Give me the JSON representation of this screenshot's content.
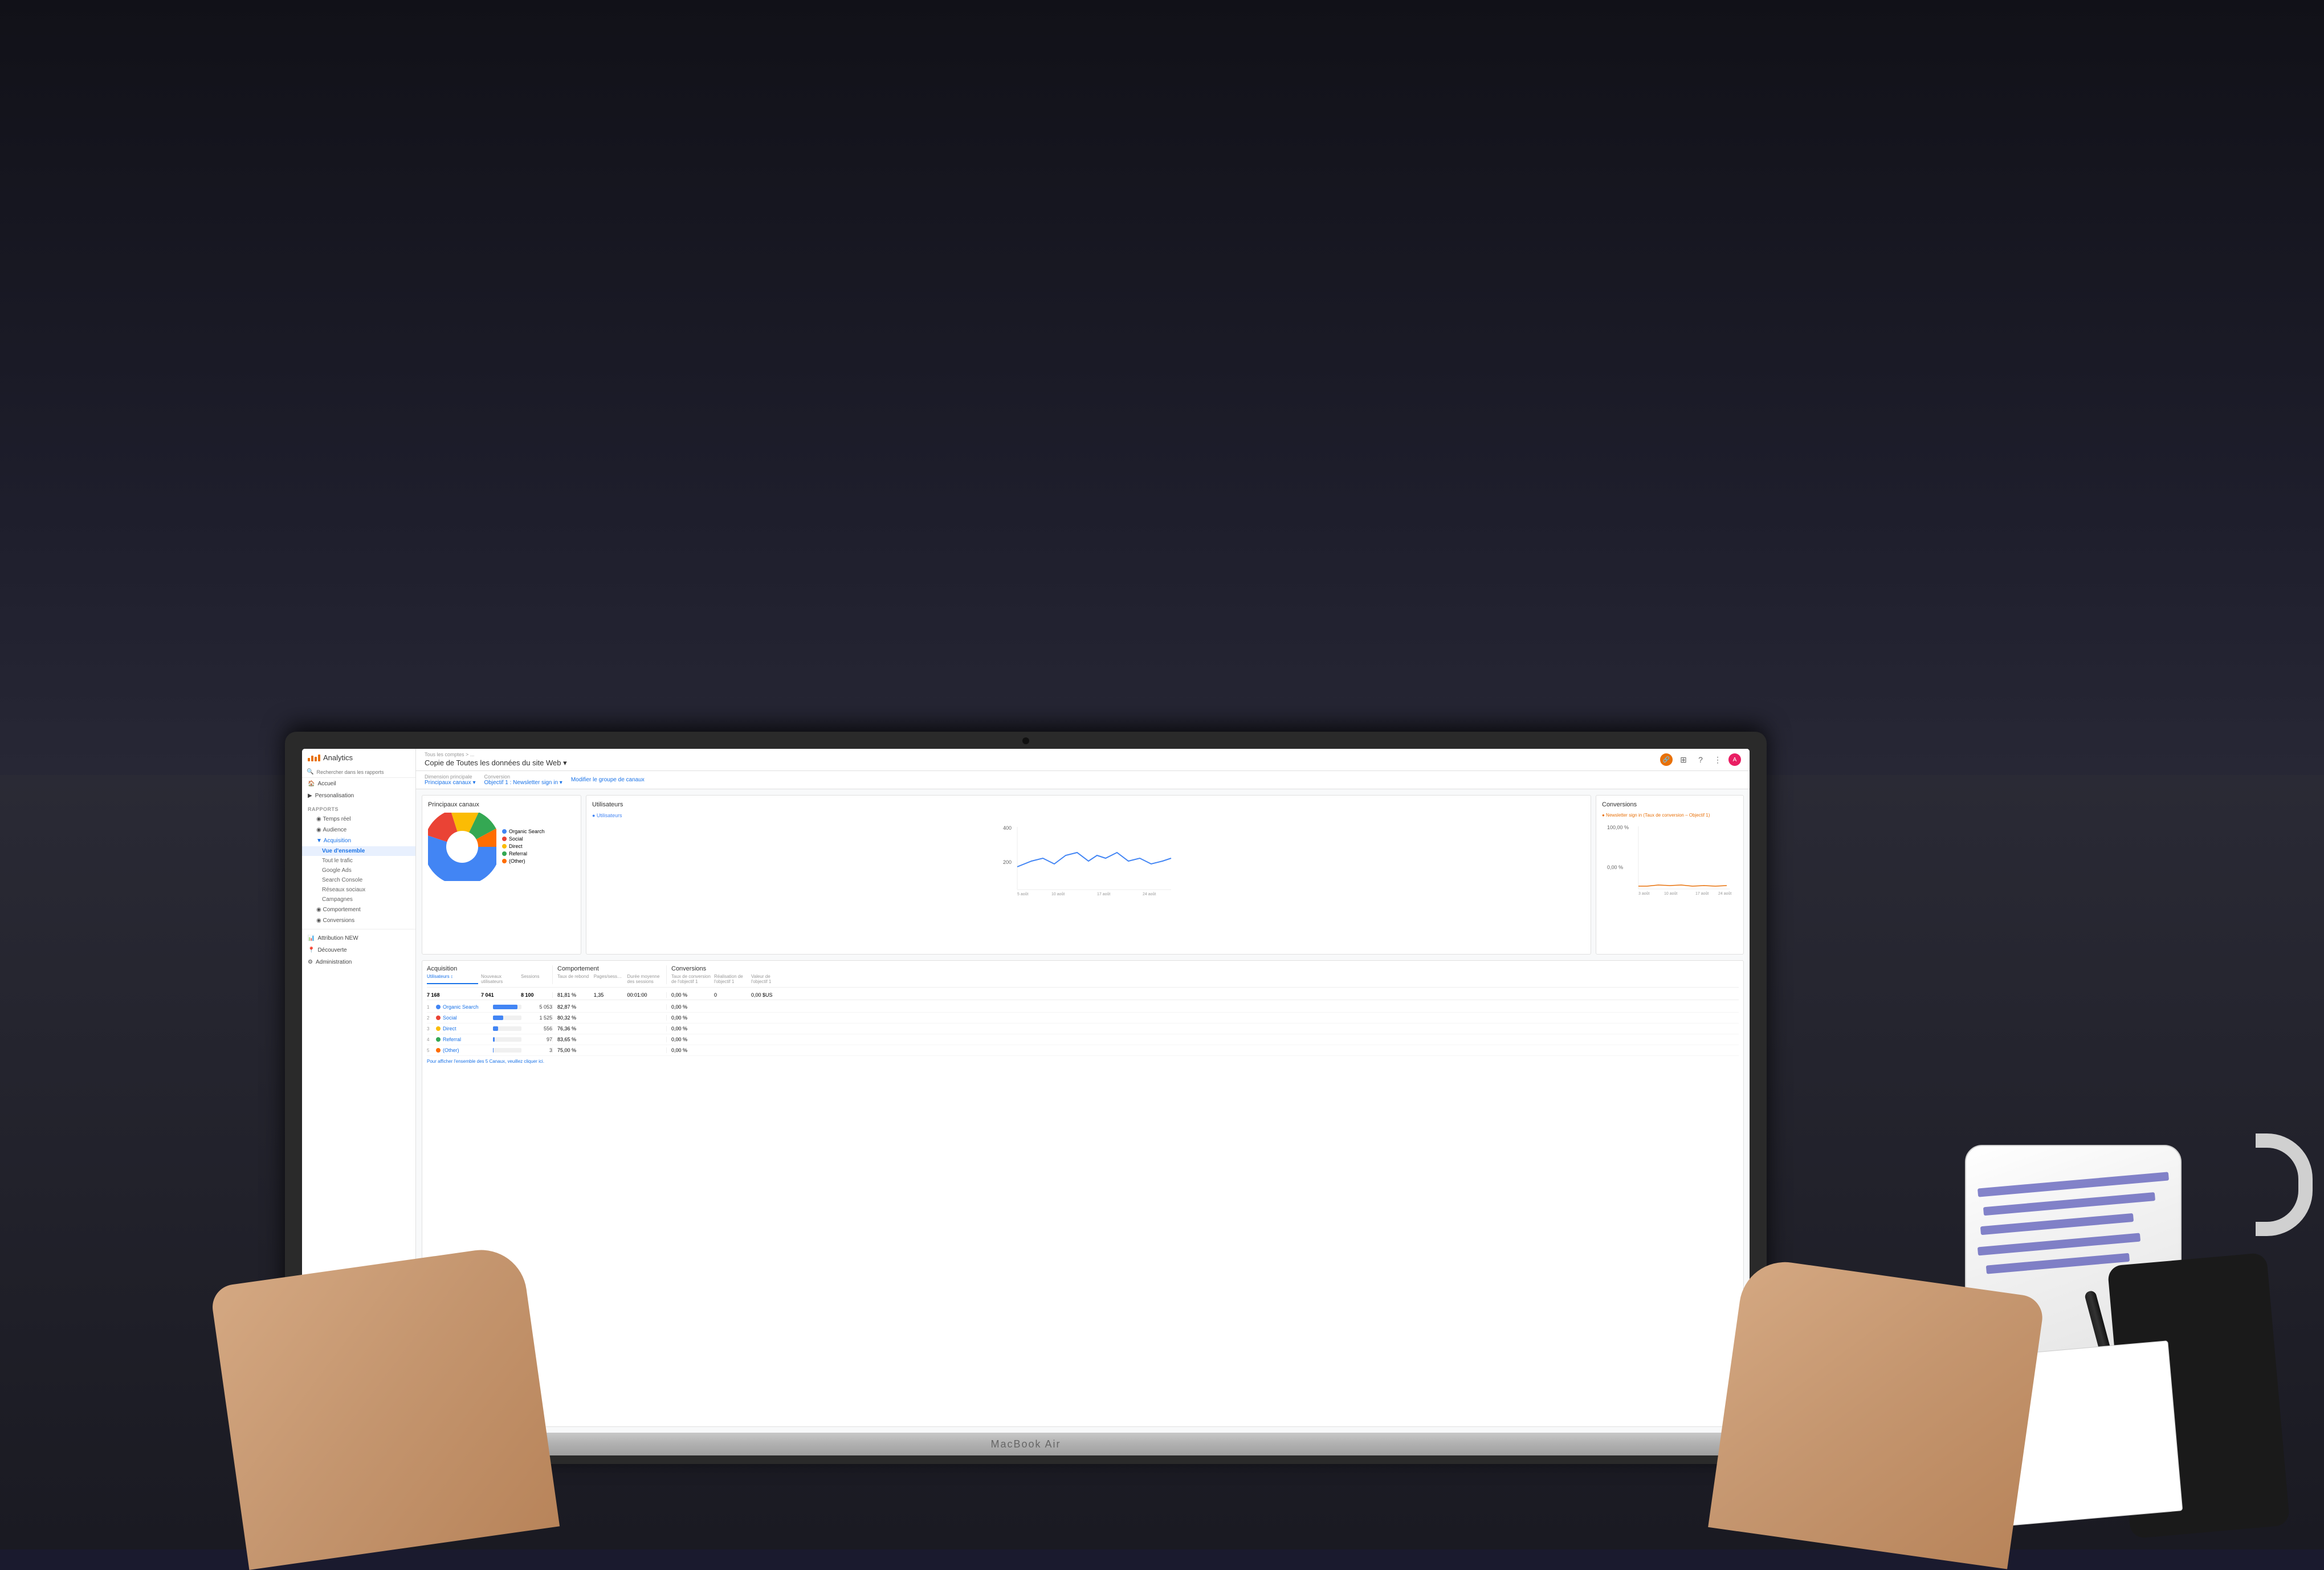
{
  "scene": {
    "laptop_label": "MacBook Air"
  },
  "analytics": {
    "title": "Analytics",
    "breadcrumb": "Tous les comptes > ...",
    "page_title": "Copie de Toutes les données du site Web ▾",
    "search_placeholder": "Rechercher dans les rapports"
  },
  "sidebar": {
    "logo_icon": "chart-bars-icon",
    "search_placeholder": "Rechercher dans les rapports",
    "nav_items": [
      {
        "id": "accueil",
        "label": "Accueil",
        "icon": "home-icon"
      },
      {
        "id": "personalisation",
        "label": "Personalisation",
        "icon": "user-icon"
      }
    ],
    "section_label": "RAPPORTS",
    "report_items": [
      {
        "id": "temps-reel",
        "label": "Temps réel",
        "icon": "clock-icon",
        "expanded": false
      },
      {
        "id": "audience",
        "label": "Audience",
        "icon": "people-icon",
        "expanded": false
      },
      {
        "id": "acquisition",
        "label": "Acquisition",
        "icon": "arrow-icon",
        "expanded": true
      },
      {
        "id": "comportement",
        "label": "Comportement",
        "icon": "cursor-icon",
        "expanded": false
      },
      {
        "id": "conversions",
        "label": "Conversions",
        "icon": "target-icon",
        "expanded": false
      }
    ],
    "acquisition_sub": [
      {
        "id": "vue-ensemble",
        "label": "Vue d'ensemble",
        "active": true
      },
      {
        "id": "tout-trafic",
        "label": "Tout le trafic"
      },
      {
        "id": "google-ads",
        "label": "Google Ads"
      },
      {
        "id": "search-console",
        "label": "Search Console"
      },
      {
        "id": "reseaux-sociaux",
        "label": "Réseaux sociaux"
      },
      {
        "id": "campagnes",
        "label": "Campagnes"
      }
    ],
    "bottom_items": [
      {
        "id": "attribution",
        "label": "Attribution NEW",
        "icon": "chart-icon"
      },
      {
        "id": "decouverte",
        "label": "Découverte",
        "icon": "location-icon"
      },
      {
        "id": "administration",
        "label": "Administration",
        "icon": "gear-icon"
      }
    ]
  },
  "filters": {
    "dimension_label": "Dimension principale",
    "dimension_value": "Principaux canaux ▾",
    "conversion_label": "Conversion",
    "conversion_value": "Objectif 1 : Newsletter sign in ▾",
    "edit_label": "Modifier le groupe de canaux"
  },
  "header_icons": {
    "share_label": "🔗",
    "save_label": "💾",
    "help_label": "?",
    "more_label": "⋮",
    "avatar_label": "A"
  },
  "section_principaux_canaux": {
    "title": "Principaux canaux",
    "pie_data": [
      {
        "label": "Organic Search",
        "color": "#4285f4",
        "pct": 55
      },
      {
        "label": "Social",
        "color": "#ea4335",
        "pct": 15
      },
      {
        "label": "Direct",
        "color": "#fbbc04",
        "pct": 12
      },
      {
        "label": "Referral",
        "color": "#34a853",
        "pct": 10
      },
      {
        "label": "(Other)",
        "color": "#ff6d00",
        "pct": 8
      }
    ]
  },
  "section_utilisateurs": {
    "title": "Utilisateurs",
    "metric_label": "● Utilisateurs",
    "peak_value": "400",
    "low_value": "200",
    "dates": [
      "5 août",
      "10 août",
      "17 août",
      "24 août"
    ]
  },
  "section_conversions_top": {
    "title": "Conversions",
    "metric_label": "● Newsletter sign in (Taux de conversion – Objectif 1)",
    "peak_value": "100,00 %",
    "low_value": "0,00 %",
    "dates": [
      "3 août",
      "10 août",
      "17 août",
      "24 août"
    ]
  },
  "section_acquisition": {
    "title": "Acquisition",
    "columns": [
      "Utilisateurs ↕",
      "Nouveaux utilisateurs",
      "Sessions"
    ],
    "total_users": "7 168",
    "total_new_users": "7 041",
    "total_sessions": "8 100",
    "rows": [
      {
        "rank": 1,
        "color": "#4285f4",
        "name": "Organic Search",
        "users": "5 053",
        "pct": 85,
        "sessions": ""
      },
      {
        "rank": 2,
        "color": "#ea4335",
        "name": "Social",
        "users": "1 525",
        "pct": 35,
        "sessions": ""
      },
      {
        "rank": 3,
        "color": "#fbbc04",
        "name": "Direct",
        "users": "556",
        "pct": 18,
        "sessions": ""
      },
      {
        "rank": 4,
        "color": "#34a853",
        "name": "Referral",
        "users": "97",
        "pct": 5,
        "sessions": ""
      },
      {
        "rank": 5,
        "color": "#ff6d00",
        "name": "(Other)",
        "users": "3",
        "pct": 1,
        "sessions": ""
      }
    ]
  },
  "section_comportement": {
    "title": "Comportement",
    "columns": [
      "Taux de rebond",
      "Pages/sess…",
      "Durée moyenne des sessions"
    ],
    "rows": [
      {
        "rebond": "81,81 %",
        "pages": "1,35",
        "duree": "00:01:00"
      },
      {
        "rebond": "82,87 %",
        "pages": "",
        "duree": ""
      },
      {
        "rebond": "80,32 %",
        "pages": "",
        "duree": ""
      },
      {
        "rebond": "76,36 %",
        "pages": "",
        "duree": ""
      },
      {
        "rebond": "83,65 %",
        "pages": "",
        "duree": ""
      },
      {
        "rebond": "75,00 %",
        "pages": "",
        "duree": ""
      }
    ]
  },
  "section_conversions_bottom": {
    "title": "Conversions",
    "columns": [
      "Taux de conversion de l'objectif 1",
      "Réalisation de l'objectif 1",
      "Valeur de l'objectif 1"
    ],
    "rows": [
      {
        "taux": "0,00 %",
        "realisation": "0",
        "valeur": "0,00 $US"
      },
      {
        "taux": "0,00 %",
        "realisation": "",
        "valeur": ""
      },
      {
        "taux": "0,00 %",
        "realisation": "",
        "valeur": ""
      },
      {
        "taux": "0,00 %",
        "realisation": "",
        "valeur": ""
      },
      {
        "taux": "0,00 %",
        "realisation": "",
        "valeur": ""
      },
      {
        "taux": "0,00 %",
        "realisation": "",
        "valeur": ""
      }
    ]
  },
  "footer_note": "Pour afficher l'ensemble des 5 Canaux, veuillez cliquer ici."
}
